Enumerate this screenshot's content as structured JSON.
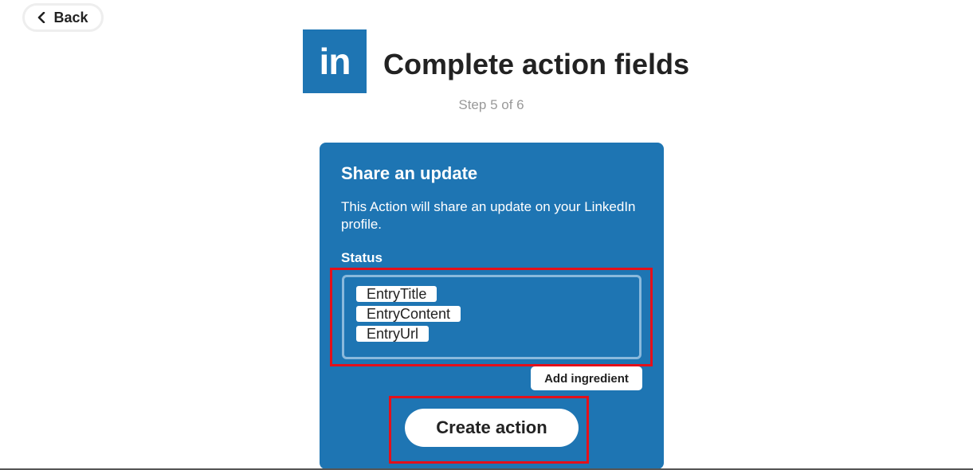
{
  "nav": {
    "back_label": "Back"
  },
  "header": {
    "logo_text": "in",
    "title": "Complete action fields",
    "step": "Step 5 of 6"
  },
  "card": {
    "title": "Share an update",
    "description": "This Action will share an update on your LinkedIn profile.",
    "status_label": "Status",
    "ingredients": [
      "EntryTitle",
      "EntryContent",
      "EntryUrl"
    ],
    "add_ingredient_label": "Add ingredient",
    "create_label": "Create action"
  },
  "colors": {
    "brand": "#1e75b3",
    "highlight": "#e4101a"
  }
}
